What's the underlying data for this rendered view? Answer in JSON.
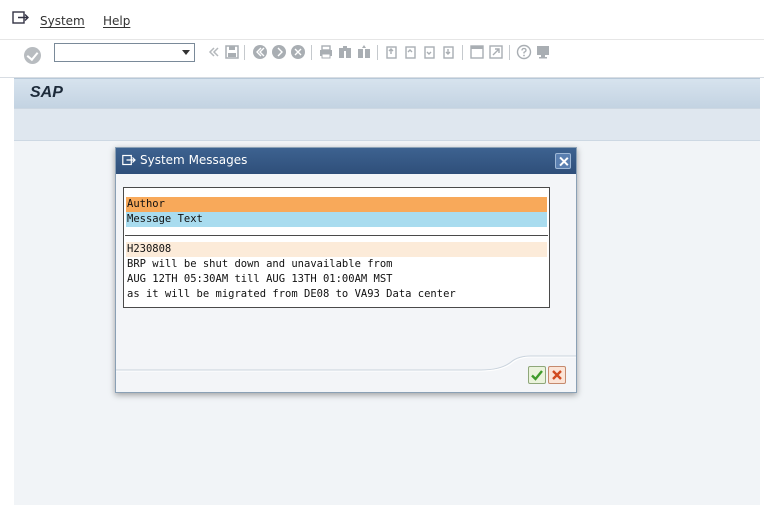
{
  "menubar": {
    "items": [
      {
        "label": "System"
      },
      {
        "label": "Help"
      }
    ]
  },
  "toolbar": {
    "command_field_value": ""
  },
  "header": {
    "title": "SAP"
  },
  "dialog": {
    "title": "System Messages",
    "columns": {
      "author": "Author",
      "message_text": "Message Text"
    },
    "message": {
      "author": "H230808",
      "lines": [
        "BRP will be shut down and unavailable from",
        "AUG 12TH 05:30AM till AUG 13TH 01:00AM MST",
        "as it will be migrated from DE08 to VA93 Data center"
      ]
    }
  },
  "colors": {
    "title_bar": "#3d6290",
    "author_row": "#f8a95a",
    "message_text_row": "#a9dcef",
    "sender_row": "#fcebd9",
    "ok_check": "#3f9b2b",
    "cancel_x": "#d14b1f"
  }
}
